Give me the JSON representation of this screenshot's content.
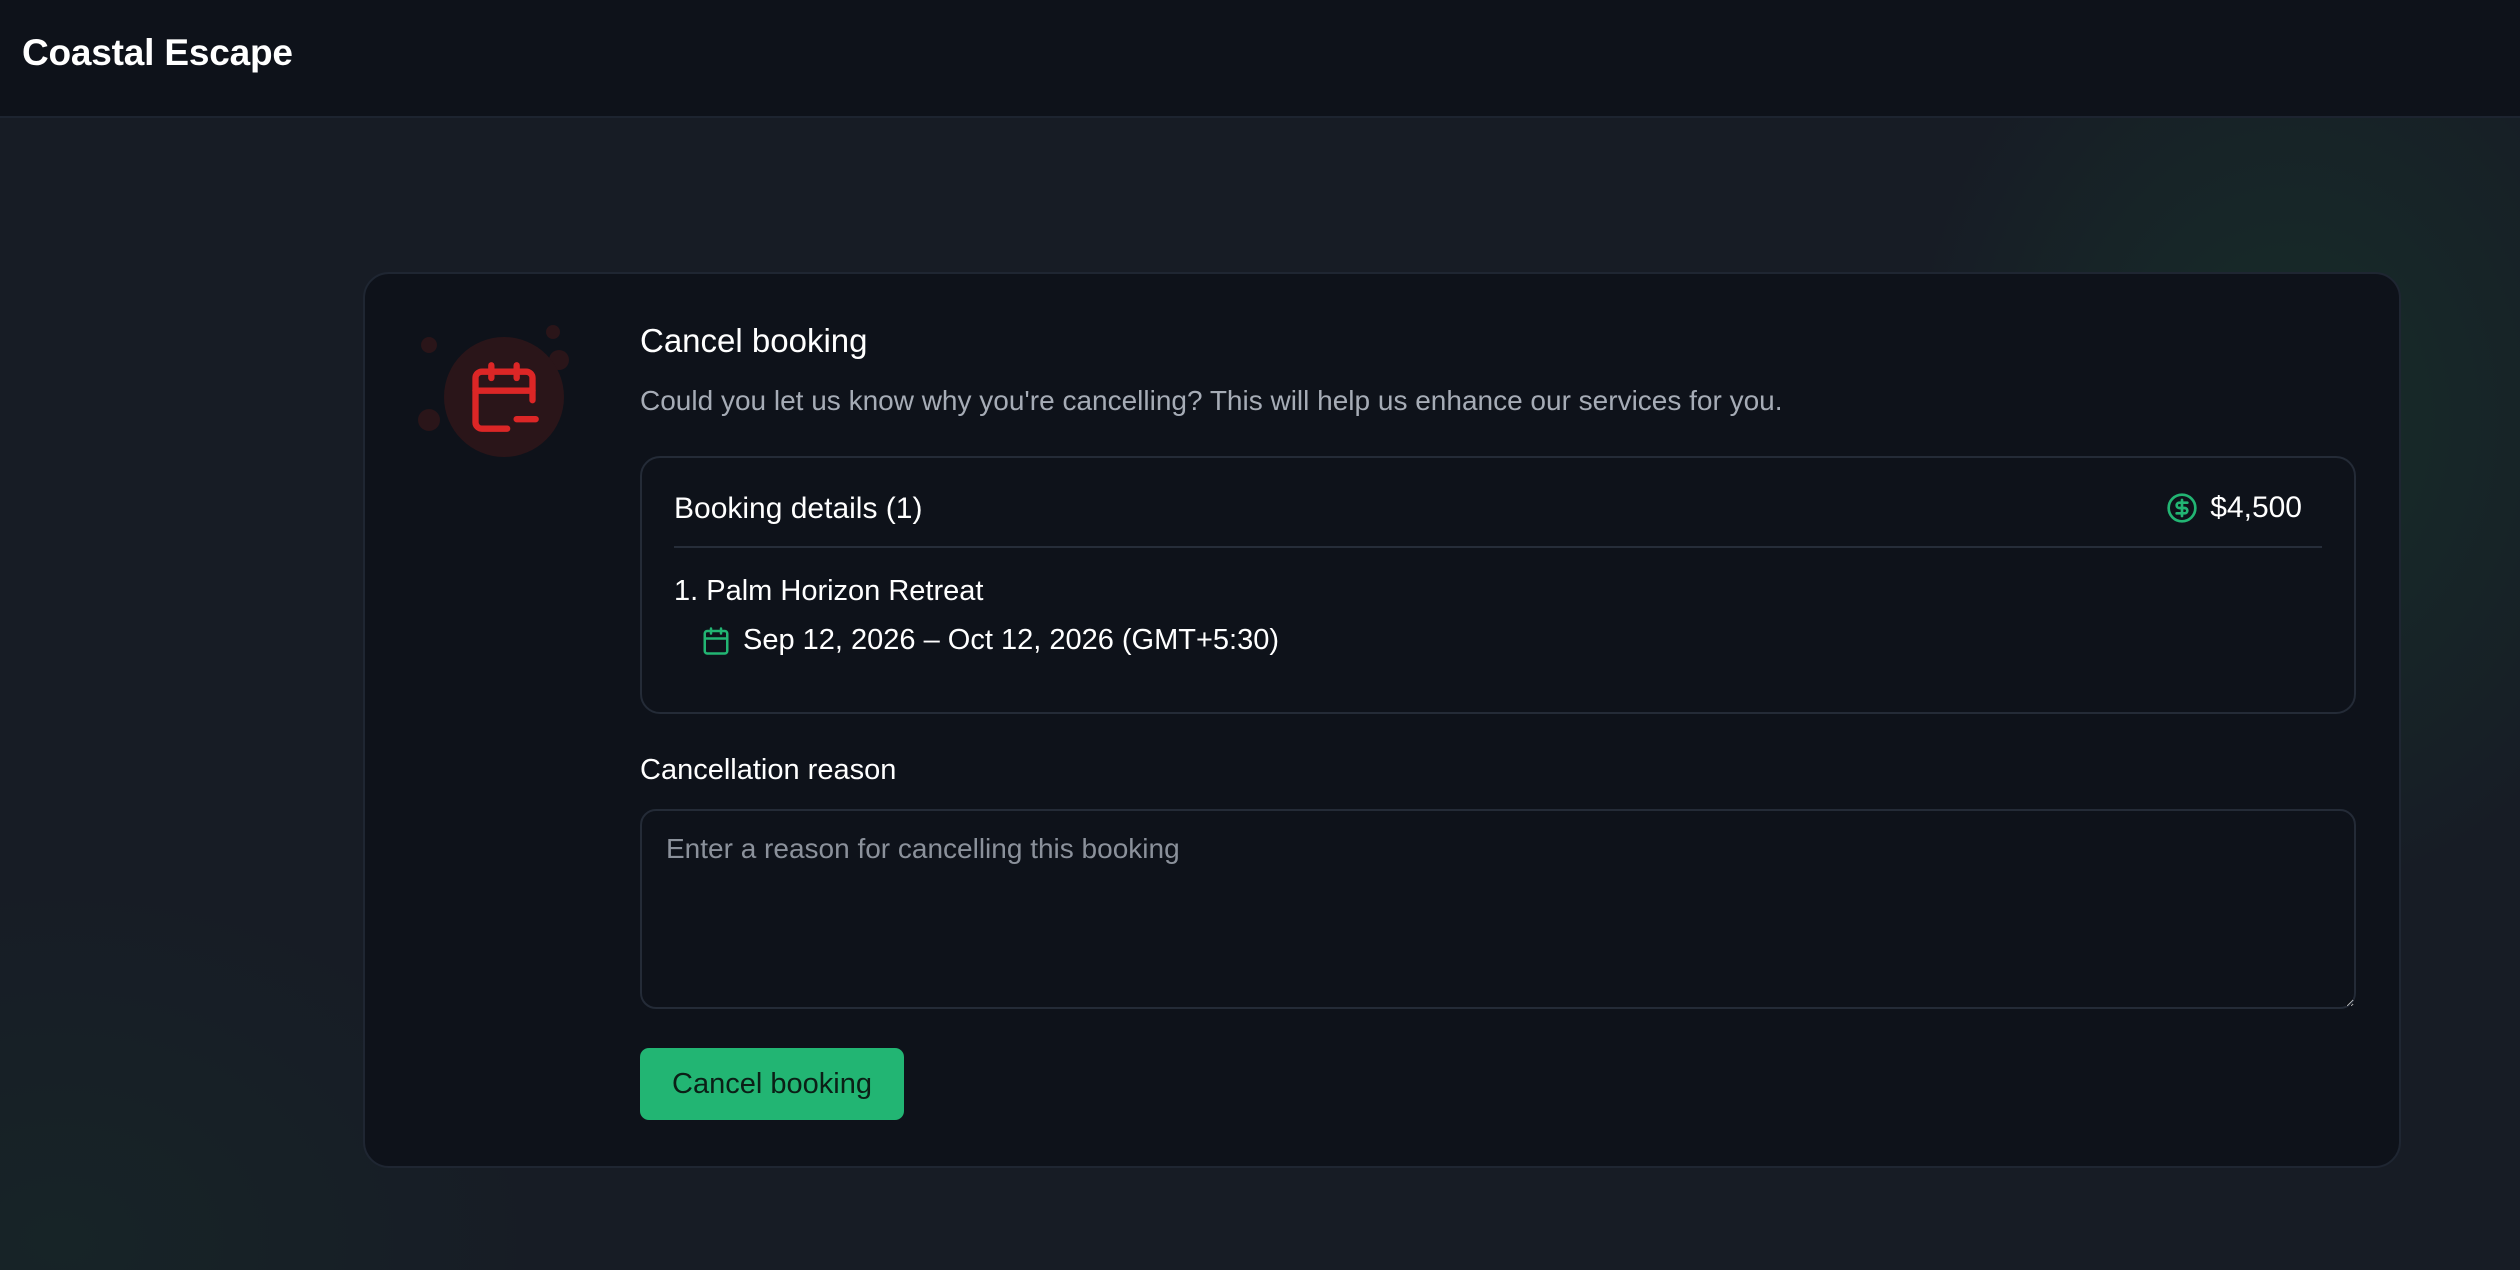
{
  "app": {
    "brand": "Coastal Escape"
  },
  "dialog": {
    "title": "Cancel booking",
    "subtitle": "Could you let us know why you're cancelling? This will help us enhance our services for you.",
    "icon": "calendar-minus-icon",
    "accent_color": "#dc2626",
    "details": {
      "title": "Booking details (1)",
      "price_icon": "dollar-circle-icon",
      "price": "$4,500",
      "items": [
        {
          "name": "1. Palm Horizon Retreat",
          "date_icon": "calendar-icon",
          "date_range": "Sep 12, 2026 – Oct 12, 2026 (GMT+5:30)"
        }
      ]
    },
    "reason": {
      "label": "Cancellation reason",
      "placeholder": "Enter a reason for cancelling this booking",
      "value": ""
    },
    "submit_label": "Cancel booking",
    "primary_color": "#22b573"
  }
}
